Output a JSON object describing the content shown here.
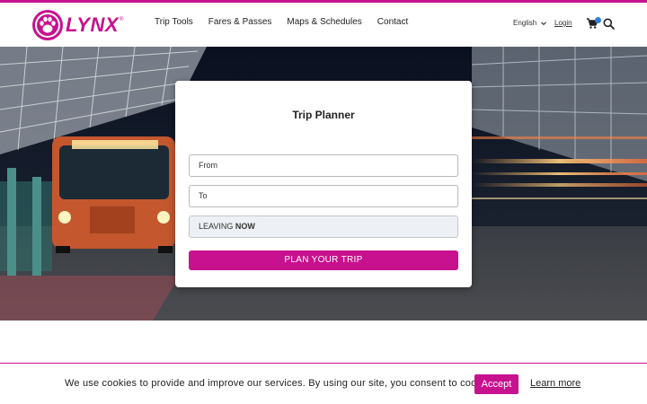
{
  "brand": {
    "name": "LYNX",
    "registered_mark": "®",
    "color": "#c8118f",
    "icon": "paw-icon"
  },
  "nav": {
    "items": [
      {
        "label": "Trip Tools"
      },
      {
        "label": "Fares & Passes"
      },
      {
        "label": "Maps & Schedules"
      },
      {
        "label": "Contact"
      }
    ]
  },
  "header_tools": {
    "language": "English",
    "language_icon": "chevron-down-icon",
    "login": "Login",
    "cart_icon": "cart-icon",
    "cart_badge_color": "#2f7fd6",
    "search_icon": "search-icon"
  },
  "trip_planner": {
    "title": "Trip Planner",
    "from_placeholder": "From",
    "to_placeholder": "To",
    "leaving_prefix": "LEAVING",
    "leaving_value": "NOW",
    "plan_button": "PLAN YOUR TRIP"
  },
  "cookie_banner": {
    "message": "We use cookies to provide and improve our services. By using our site, you consent to cookies.",
    "accept": "Accept",
    "learn_more": "Learn more"
  }
}
